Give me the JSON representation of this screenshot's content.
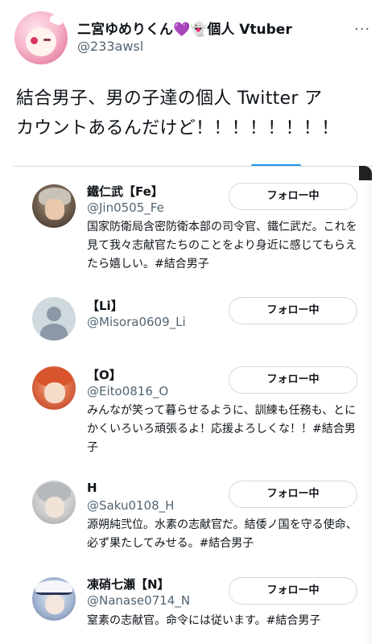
{
  "tweet": {
    "author_name": "二宮ゆめりくん💜👻個人 Vtuber",
    "author_handle": "@233awsl",
    "more_icon": "···",
    "text_line1": "結合男子、男の子達の個人 Twitter ア",
    "text_line2": "カウントあるんだけど！！！！！！！！"
  },
  "card": {
    "users": [
      {
        "name": "鐵仁武【Fe】",
        "handle": "@Jin0505_Fe",
        "bio": "国家防衛局含密防衛本部の司令官、鐵仁武だ。これを見て我々志献官たちのことをより身近に感じてもらえたら嬉しい。#結合男子",
        "button": "フォロー中"
      },
      {
        "name": "【Li】",
        "handle": "@Misora0609_Li",
        "bio": "",
        "button": "フォロー中"
      },
      {
        "name": "【O】",
        "handle": "@Eito0816_O",
        "bio": "みんなが笑って暮らせるように、訓練も任務も、とにかくいろいろ頑張るよ！応援よろしくな！！#結合男子",
        "button": "フォロー中"
      },
      {
        "name": "H",
        "handle": "@Saku0108_H",
        "bio": "源朔純弐位。水素の志献官だ。結倭ノ国を守る使命、必ず果たしてみせる。#結合男子",
        "button": "フォロー中"
      },
      {
        "name": "凍硝七瀬【N】",
        "handle": "@Nanase0714_N",
        "bio": "窒素の志献官。命令には従います。#結合男子",
        "button": "フォロー中"
      }
    ]
  }
}
